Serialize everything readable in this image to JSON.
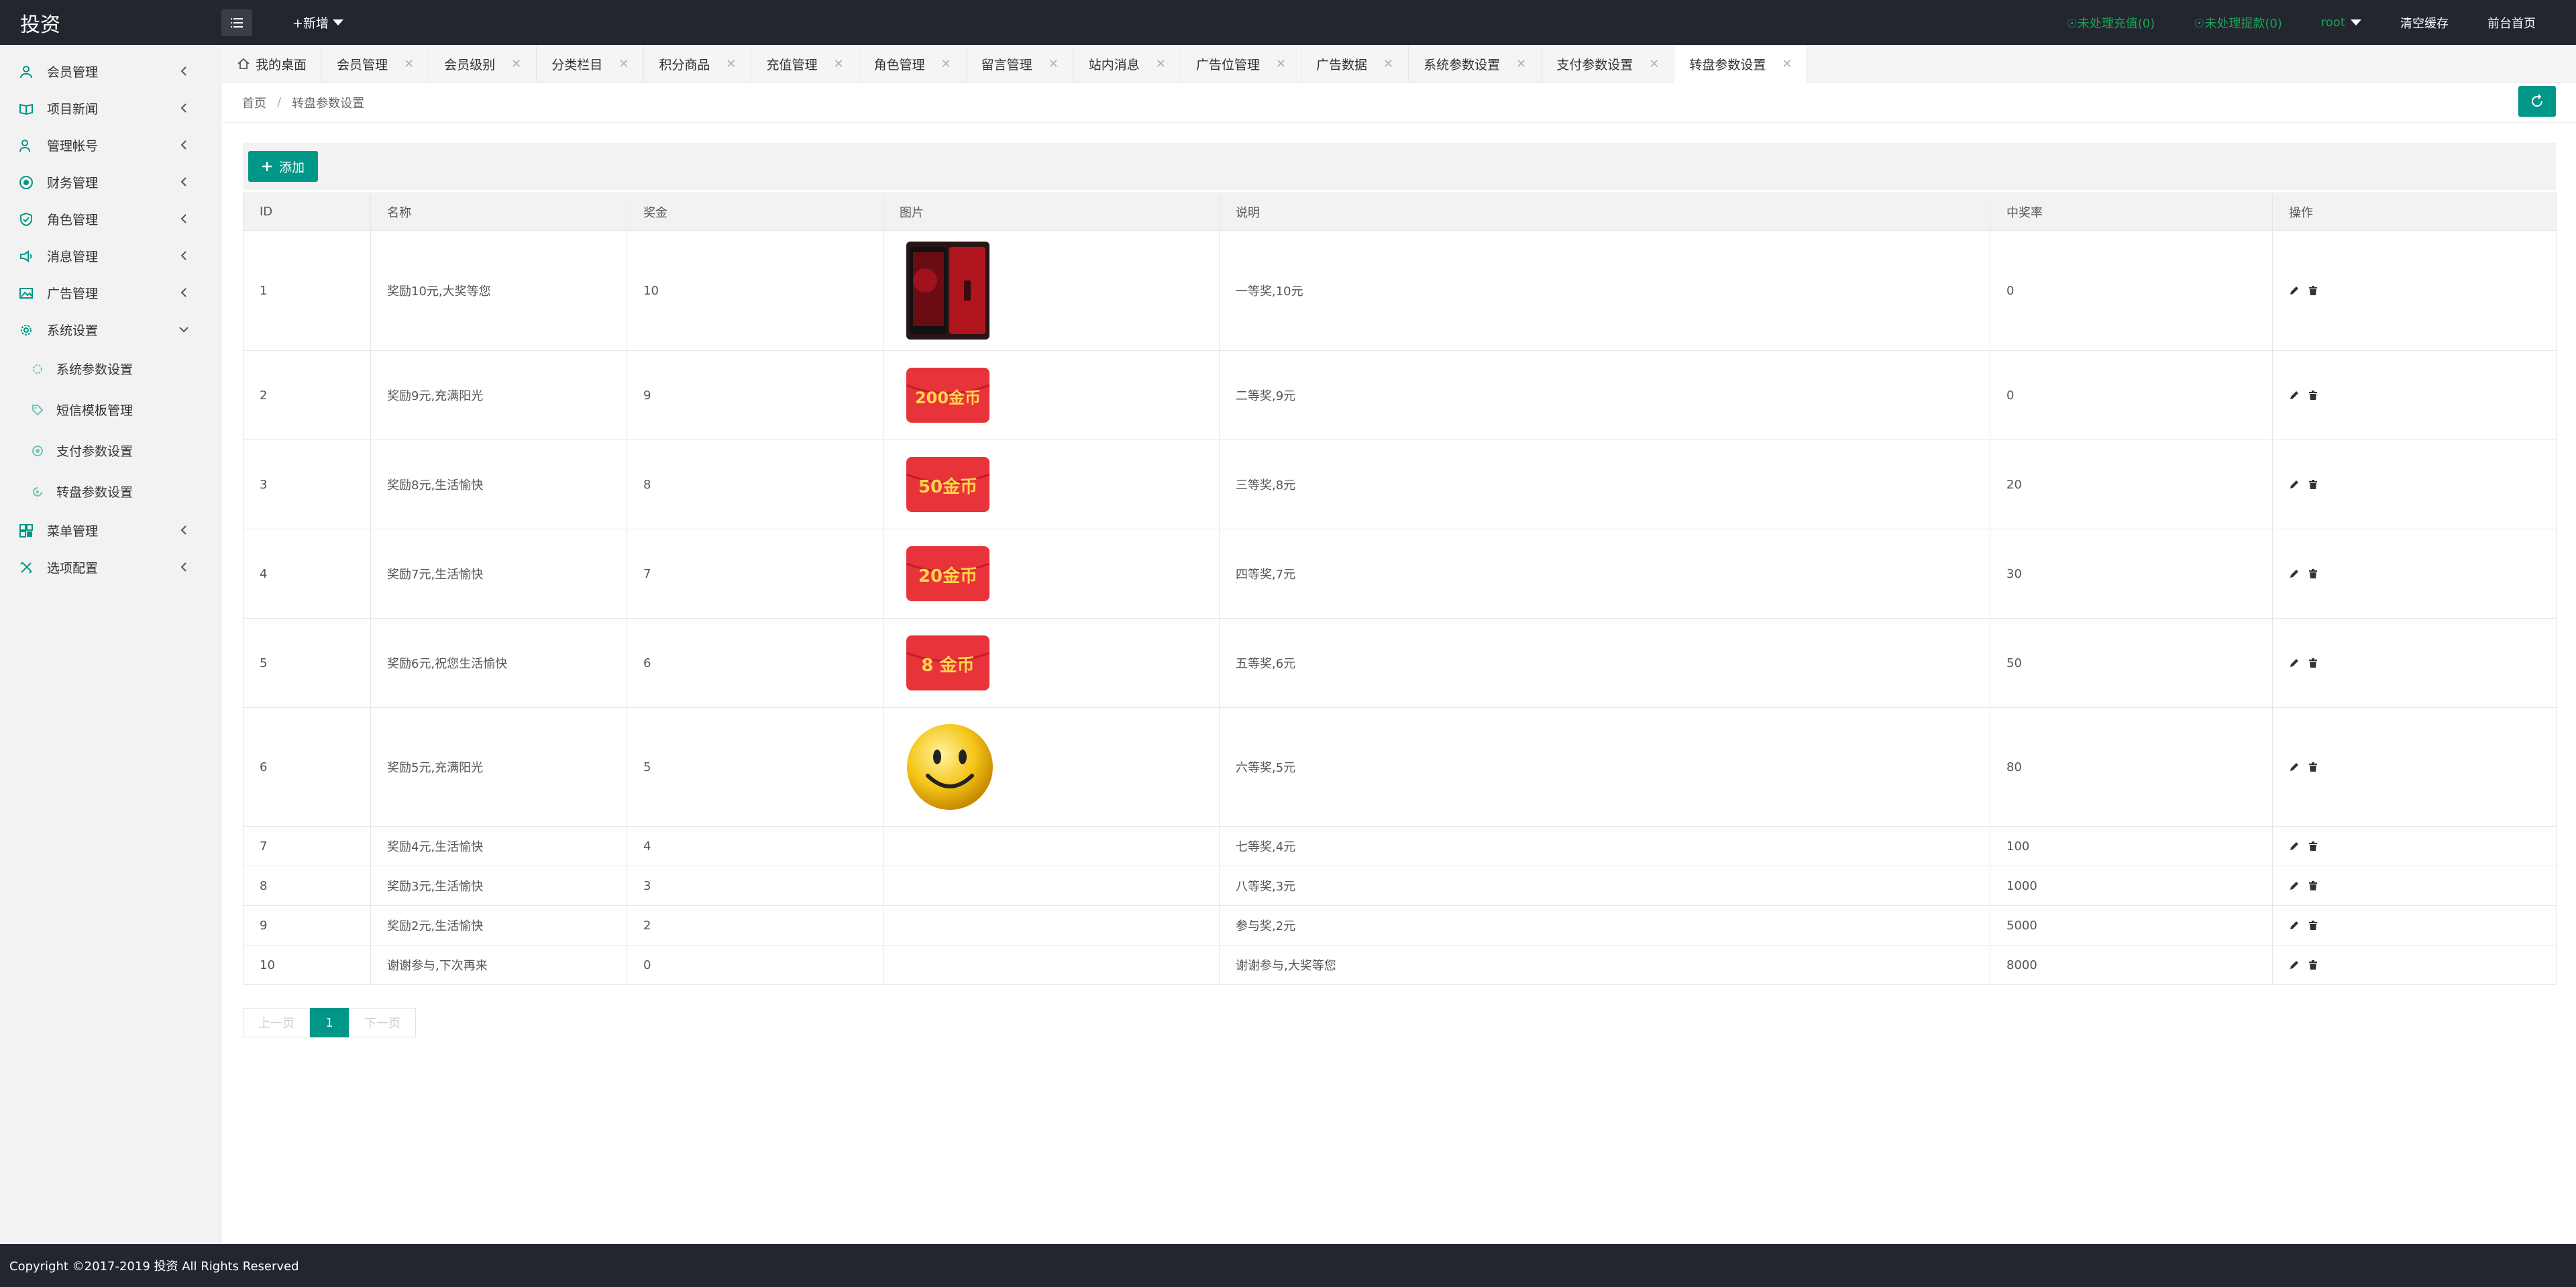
{
  "header": {
    "logo": "投资",
    "new_label": "+新增",
    "pending_recharge": "☉未处理充值(0)",
    "pending_withdraw": "☉未处理提款(0)",
    "user": "root",
    "clear_cache": "清空缓存",
    "front_home": "前台首页"
  },
  "sidebar": {
    "items": [
      {
        "label": "会员管理",
        "icon": "user-icon"
      },
      {
        "label": "项目新闻",
        "icon": "book-icon"
      },
      {
        "label": "管理帐号",
        "icon": "account-icon"
      },
      {
        "label": "财务管理",
        "icon": "finance-icon"
      },
      {
        "label": "角色管理",
        "icon": "shield-icon"
      },
      {
        "label": "消息管理",
        "icon": "message-icon"
      },
      {
        "label": "广告管理",
        "icon": "image-icon"
      },
      {
        "label": "系统设置",
        "icon": "gear-icon"
      }
    ],
    "sub_items": [
      {
        "label": "系统参数设置",
        "icon": "gear-icon"
      },
      {
        "label": "短信模板管理",
        "icon": "tag-icon"
      },
      {
        "label": "支付参数设置",
        "icon": "radio-icon"
      },
      {
        "label": "转盘参数设置",
        "icon": "circle-arrow-icon"
      }
    ],
    "items_after": [
      {
        "label": "菜单管理",
        "icon": "menu-icon"
      },
      {
        "label": "选项配置",
        "icon": "config-icon"
      }
    ]
  },
  "tabs": [
    {
      "label": "我的桌面"
    },
    {
      "label": "会员管理"
    },
    {
      "label": "会员级别"
    },
    {
      "label": "分类栏目"
    },
    {
      "label": "积分商品"
    },
    {
      "label": "充值管理"
    },
    {
      "label": "角色管理"
    },
    {
      "label": "留言管理"
    },
    {
      "label": "站内消息"
    },
    {
      "label": "广告位管理"
    },
    {
      "label": "广告数据"
    },
    {
      "label": "系统参数设置"
    },
    {
      "label": "支付参数设置"
    },
    {
      "label": "转盘参数设置"
    }
  ],
  "breadcrumb": {
    "home": "首页",
    "sep": "/",
    "current": "转盘参数设置"
  },
  "toolbar": {
    "add_label": "添加"
  },
  "table": {
    "headers": [
      "ID",
      "名称",
      "奖金",
      "图片",
      "说明",
      "中奖率",
      "操作"
    ],
    "rows": [
      {
        "id": "1",
        "name": "奖励10元,大奖等您",
        "bonus": "10",
        "image": "phone",
        "desc": "一等奖,10元",
        "rate": "0"
      },
      {
        "id": "2",
        "name": "奖励9元,充满阳光",
        "bonus": "9",
        "image": "coupon",
        "coupon_text": "200金币",
        "desc": "二等奖,9元",
        "rate": "0"
      },
      {
        "id": "3",
        "name": "奖励8元,生活愉快",
        "bonus": "8",
        "image": "coupon",
        "coupon_text": "50金币",
        "desc": "三等奖,8元",
        "rate": "20"
      },
      {
        "id": "4",
        "name": "奖励7元,生活愉快",
        "bonus": "7",
        "image": "coupon",
        "coupon_text": "20金币",
        "desc": "四等奖,7元",
        "rate": "30"
      },
      {
        "id": "5",
        "name": "奖励6元,祝您生活愉快",
        "bonus": "6",
        "image": "coupon",
        "coupon_text": "8 金币",
        "desc": "五等奖,6元",
        "rate": "50"
      },
      {
        "id": "6",
        "name": "奖励5元,充满阳光",
        "bonus": "5",
        "image": "smiley",
        "desc": "六等奖,5元",
        "rate": "80"
      },
      {
        "id": "7",
        "name": "奖励4元,生活愉快",
        "bonus": "4",
        "image": "",
        "desc": "七等奖,4元",
        "rate": "100"
      },
      {
        "id": "8",
        "name": "奖励3元,生活愉快",
        "bonus": "3",
        "image": "",
        "desc": "八等奖,3元",
        "rate": "1000"
      },
      {
        "id": "9",
        "name": "奖励2元,生活愉快",
        "bonus": "2",
        "image": "",
        "desc": "参与奖,2元",
        "rate": "5000"
      },
      {
        "id": "10",
        "name": "谢谢参与,下次再来",
        "bonus": "0",
        "image": "",
        "desc": "谢谢参与,大奖等您",
        "rate": "8000"
      }
    ]
  },
  "pager": {
    "prev": "上一页",
    "current": "1",
    "next": "下一页"
  },
  "footer": {
    "copyright": "Copyright ©2017-2019 投资 All Rights Reserved"
  },
  "colors": {
    "accent": "#009688",
    "header_bg": "#23262e",
    "status_green": "#1aa35a"
  }
}
